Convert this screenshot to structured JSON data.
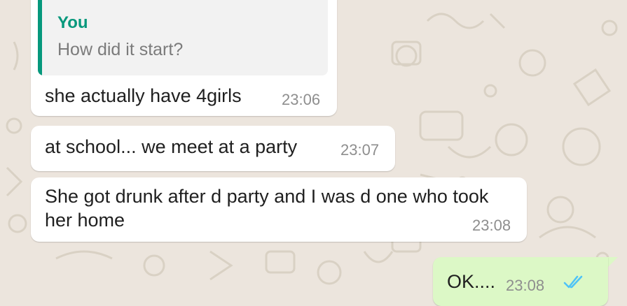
{
  "chat": {
    "messages": [
      {
        "reply_author": "You",
        "reply_text": "How did it start?",
        "text": "she actually have 4girls",
        "time": "23:06"
      },
      {
        "text": "at school... we meet at a party",
        "time": "23:07"
      },
      {
        "text": "She got drunk after d party and I was d one who took her home",
        "time": "23:08"
      },
      {
        "text": "OK....",
        "time": "23:08",
        "status_icon": "double-check-read-icon"
      }
    ]
  },
  "colors": {
    "wallpaper": "#ece5dd",
    "incoming_bubble": "#ffffff",
    "outgoing_bubble": "#dcf8c6",
    "reply_accent": "#06987c",
    "read_ticks": "#4fc3f7"
  }
}
